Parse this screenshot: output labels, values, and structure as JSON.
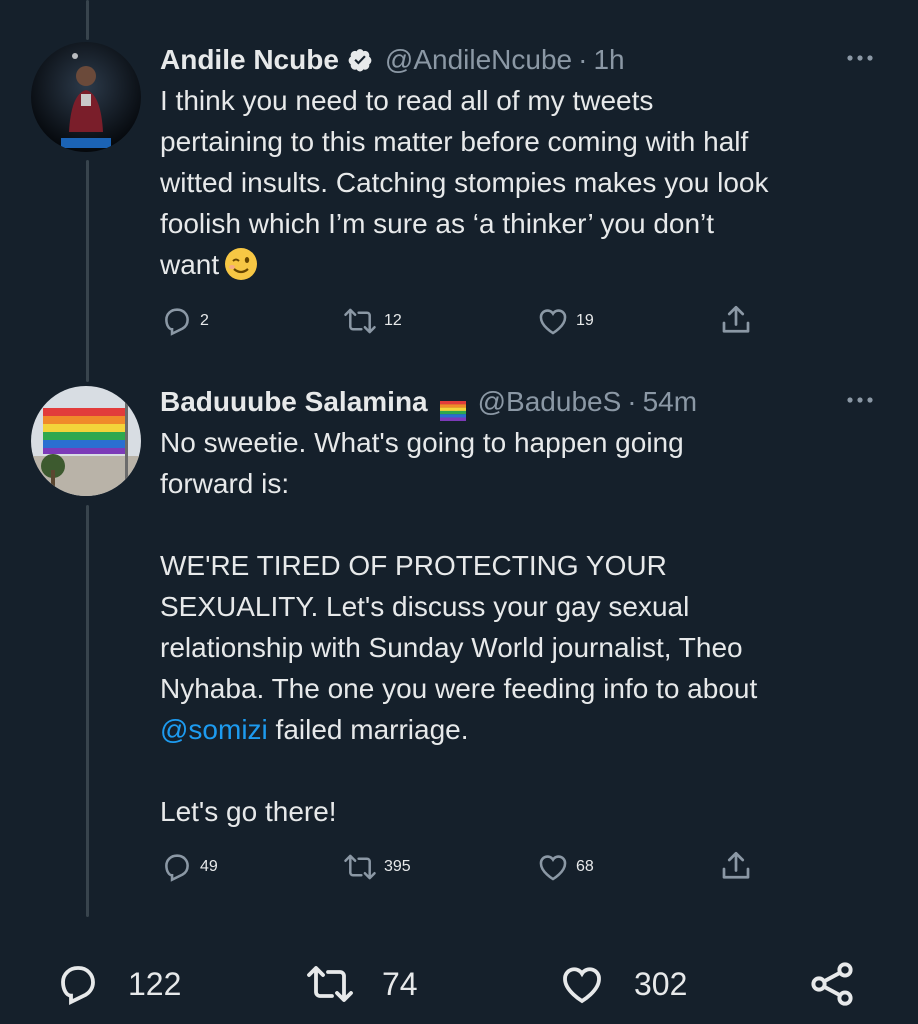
{
  "tweets": [
    {
      "display_name": "Andile Ncube",
      "verified": true,
      "handle": "@AndileNcube",
      "time": "1h",
      "text_lines": [
        "I think you need to read all of my tweets",
        "pertaining to this matter before coming with half",
        "witted insults. Catching stompies makes you look",
        "foolish which I’m sure as ‘a thinker’ you don’t",
        "want"
      ],
      "emoji": "winking-face",
      "replies": "2",
      "retweets": "12",
      "likes": "19"
    },
    {
      "display_name": "Baduuube Salamina",
      "flag": "rainbow-flag",
      "handle": "@BadubeS",
      "time": "54m",
      "para1_lines": [
        "No sweetie. What's going to happen going",
        "forward is:"
      ],
      "para2_lines": [
        "WE'RE TIRED OF PROTECTING YOUR",
        "SEXUALITY. Let's discuss your gay sexual",
        "relationship with Sunday World journalist, Theo",
        "Nyhaba. The one you were feeding info to about"
      ],
      "mention": "@somizi",
      "after_mention": " failed marriage.",
      "para3": "Let's go there!",
      "replies": "49",
      "retweets": "395",
      "likes": "68"
    }
  ],
  "dot": "·",
  "bottom_bar": {
    "replies": "122",
    "retweets": "74",
    "likes": "302"
  },
  "colors": {
    "background": "#15202b",
    "text": "#e7e9ea",
    "muted": "#8b98a5",
    "link": "#1d9bf0",
    "thread_line": "#38444d"
  },
  "icons": [
    "reply-icon",
    "retweet-icon",
    "like-icon",
    "share-icon",
    "more-icon",
    "verified-icon",
    "rainbow-flag-icon",
    "winking-face-emoji"
  ]
}
